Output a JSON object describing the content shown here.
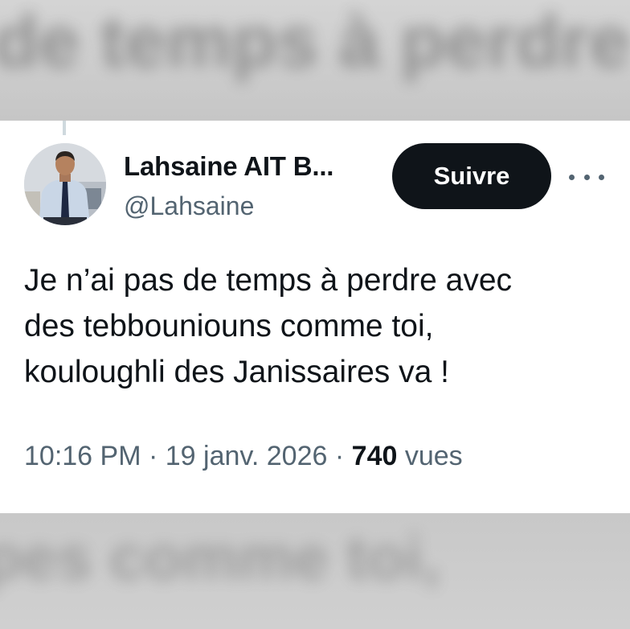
{
  "background": {
    "top_blur_text": "de temps à perdre",
    "bottom_blur_text": "pes comme toi,"
  },
  "tweet": {
    "author_name": "Lahsaine AIT B...",
    "handle": "@Lahsaine",
    "follow_label": "Suivre",
    "more_icon": "more-horizontal-icon",
    "text_lines": [
      "Je n’ai pas de temps à perdre avec",
      "des tebbouniouns comme toi,",
      "kouloughli des Janissaires va !"
    ],
    "time": "10:16 PM",
    "separator": "·",
    "date": "19 janv. 2026",
    "views_count": "740",
    "views_label": "vues"
  },
  "colors": {
    "primary_text": "#0f1419",
    "secondary_text": "#536471",
    "button_bg": "#0f1419",
    "button_text": "#ffffff",
    "card_bg": "#ffffff"
  }
}
